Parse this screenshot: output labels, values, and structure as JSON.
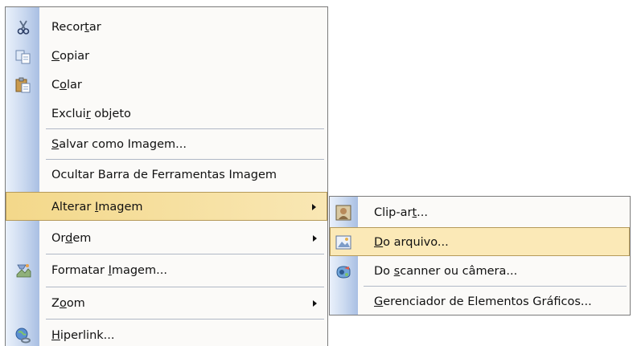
{
  "main_menu": {
    "items": [
      {
        "pre": "Recor",
        "u": "t",
        "post": "ar",
        "icon": "scissors-icon"
      },
      {
        "pre": "",
        "u": "C",
        "post": "opiar",
        "icon": "copy-icon"
      },
      {
        "pre": "C",
        "u": "o",
        "post": "lar",
        "icon": "paste-icon"
      },
      {
        "pre": "Exclui",
        "u": "r",
        "post": " objeto",
        "icon": ""
      },
      {
        "pre": "",
        "u": "S",
        "post": "alvar como Imagem...",
        "icon": ""
      },
      {
        "pre": "Ocultar Barra de Ferramentas Imagem",
        "u": "",
        "post": "",
        "icon": ""
      },
      {
        "pre": "Alterar ",
        "u": "I",
        "post": "magem",
        "icon": "",
        "submenu": true
      },
      {
        "pre": "Or",
        "u": "d",
        "post": "em",
        "icon": "",
        "submenu": true
      },
      {
        "pre": "Formatar ",
        "u": "I",
        "post": "magem...",
        "icon": "format-picture-icon"
      },
      {
        "pre": "Z",
        "u": "o",
        "post": "om",
        "icon": "",
        "submenu": true
      },
      {
        "pre": "",
        "u": "H",
        "post": "iperlink...",
        "icon": "hyperlink-icon"
      }
    ]
  },
  "sub_menu": {
    "items": [
      {
        "pre": "Clip-ar",
        "u": "t",
        "post": "...",
        "icon": "clip-art-icon"
      },
      {
        "pre": "",
        "u": "D",
        "post": "o arquivo...",
        "icon": "from-file-icon"
      },
      {
        "pre": "Do ",
        "u": "s",
        "post": "canner ou câmera...",
        "icon": "scanner-camera-icon"
      },
      {
        "pre": "",
        "u": "G",
        "post": "erenciador de Elementos Gráficos...",
        "icon": ""
      }
    ]
  },
  "colors": {
    "highlight": "#fbe9b7",
    "highlight_border": "#b59a5a",
    "icon_strip": "#c9d8ef"
  }
}
